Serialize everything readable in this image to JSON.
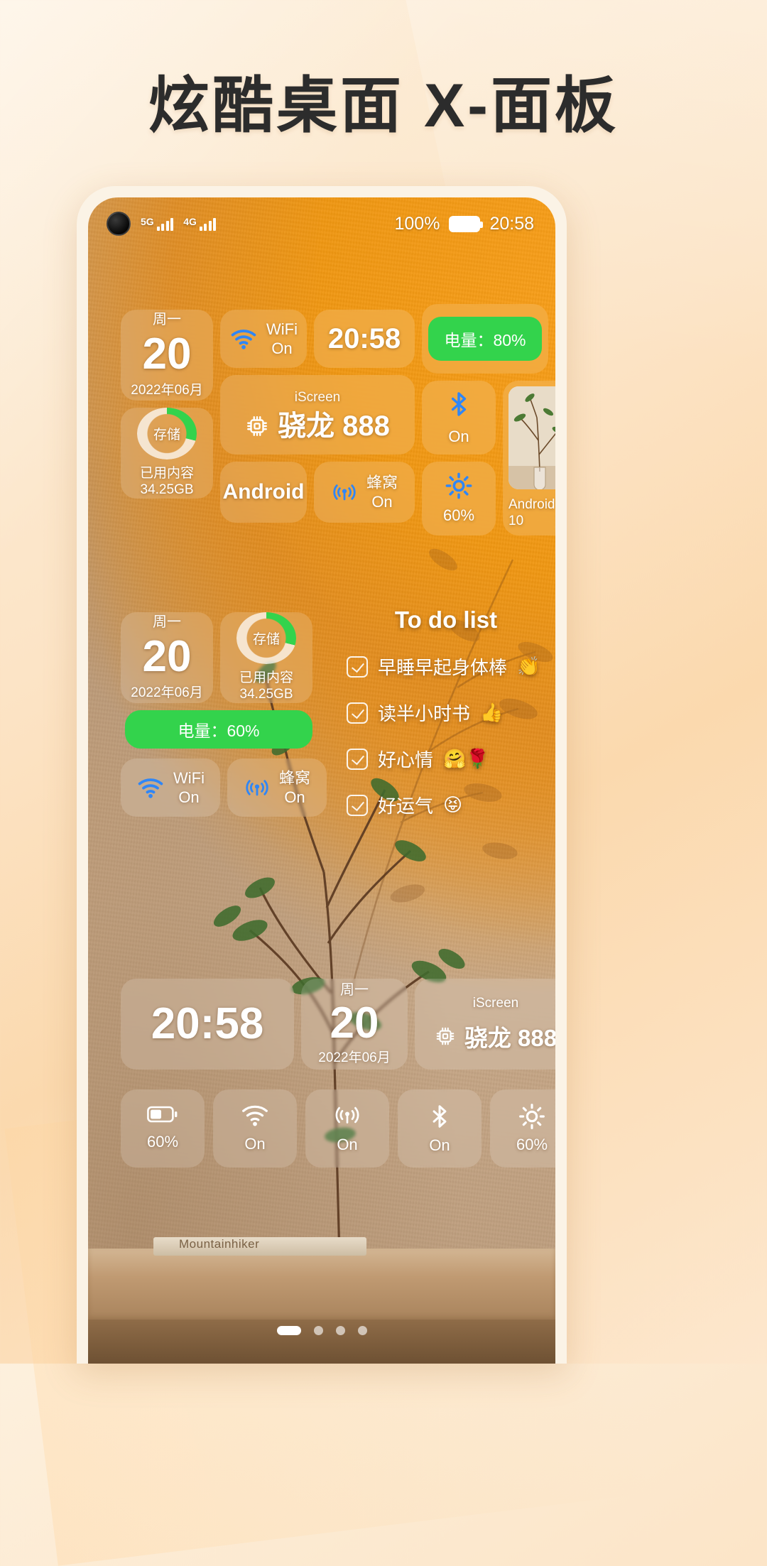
{
  "promo": {
    "headline": "炫酷桌面 X-面板"
  },
  "status_bar": {
    "network_primary": "5G",
    "network_secondary": "4G",
    "battery_percent": "100%",
    "clock": "20:58"
  },
  "widgets": {
    "date_top": {
      "weekday": "周一",
      "day": "20",
      "month": "2022年06月"
    },
    "wifi_top": {
      "label": "WiFi",
      "state": "On",
      "icon": "wifi-icon"
    },
    "clock_top": {
      "time": "20:58"
    },
    "battery_pill_top": {
      "text": "电量：80%",
      "color": "#33d34c"
    },
    "storage_top": {
      "ring_label": "存储",
      "caption": "已用内容",
      "value": "34.25GB",
      "used_percent": 29
    },
    "chip_top": {
      "brand": "iScreen",
      "chip": "骁龙 888",
      "os": "Android",
      "icon": "cpu-chip-icon"
    },
    "cellular_top": {
      "label": "蜂窝",
      "state": "On",
      "icon": "cellular-icon"
    },
    "bluetooth_top": {
      "state": "On",
      "icon": "bluetooth-icon"
    },
    "brightness_top": {
      "value": "60%",
      "icon": "brightness-icon"
    },
    "photo_top": {
      "caption": "Android 10"
    },
    "date_mid": {
      "weekday": "周一",
      "day": "20",
      "month": "2022年06月"
    },
    "storage_mid": {
      "ring_label": "存储",
      "caption": "已用内容",
      "value": "34.25GB",
      "used_percent": 29
    },
    "battery_pill_mid": {
      "text": "电量：60%",
      "color": "#33d34c"
    },
    "wifi_mid": {
      "label": "WiFi",
      "state": "On",
      "icon": "wifi-icon"
    },
    "cellular_mid": {
      "label": "蜂窝",
      "state": "On",
      "icon": "cellular-icon"
    },
    "clock_bottom": {
      "time": "20:58"
    },
    "date_bottom": {
      "weekday": "周一",
      "day": "20",
      "month": "2022年06月"
    },
    "chip_bottom": {
      "brand": "iScreen",
      "chip": "骁龙 888",
      "icon": "cpu-chip-icon"
    }
  },
  "todo": {
    "title": "To do list",
    "items": [
      {
        "text": "早睡早起身体棒",
        "emoji": "👏"
      },
      {
        "text": "读半小时书",
        "emoji": "👍"
      },
      {
        "text": "好心情",
        "emoji": "🤗🌹"
      },
      {
        "text": "好运气",
        "emoji": "😝"
      }
    ]
  },
  "control_row": [
    {
      "name": "battery-toggle",
      "icon": "battery-icon",
      "label": "60%"
    },
    {
      "name": "wifi-toggle",
      "icon": "wifi-icon",
      "label": "On"
    },
    {
      "name": "cellular-toggle",
      "icon": "cellular-icon",
      "label": "On"
    },
    {
      "name": "bluetooth-toggle",
      "icon": "bluetooth-icon",
      "label": "On"
    },
    {
      "name": "brightness-toggle",
      "icon": "brightness-icon",
      "label": "60%"
    }
  ],
  "desk": {
    "book_label": "Mountainhiker"
  },
  "pager": {
    "total": 4,
    "active": 1
  }
}
